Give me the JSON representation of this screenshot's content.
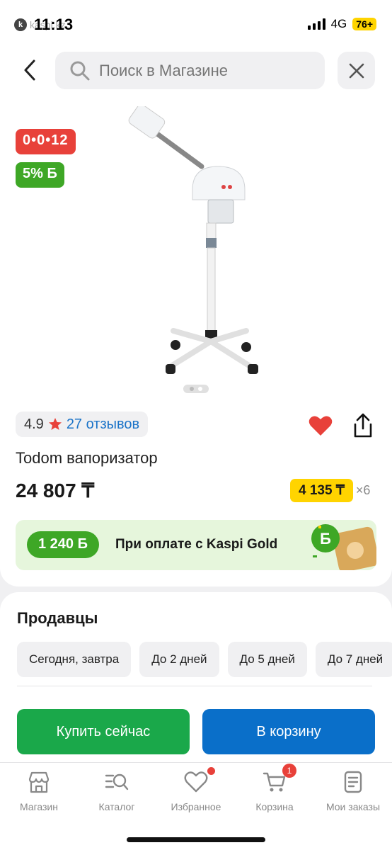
{
  "status_bar": {
    "time": "11:13",
    "app_hint": "kaspi.kz",
    "network": "4G",
    "battery": "76+"
  },
  "header": {
    "search_placeholder": "Поиск в Магазине"
  },
  "product": {
    "timer": "0•0•12",
    "bonus_badge": "5% Б",
    "rating": "4.9",
    "reviews": "27 отзывов",
    "title": "Todom вапоризатор",
    "price": "24 807 ₸",
    "installment_amount": "4 135 ₸",
    "installment_months": "×6",
    "gold_bonus": "1 240 Б",
    "gold_text": "При оплате с Kaspi Gold"
  },
  "sellers": {
    "title": "Продавцы",
    "filters": [
      "Сегодня, завтра",
      "До 2 дней",
      "До 5 дней",
      "До 7 дней"
    ],
    "buy_now": "Купить сейчас",
    "to_cart": "В корзину"
  },
  "bottom_nav": {
    "items": [
      {
        "label": "Магазин",
        "icon": "store-icon"
      },
      {
        "label": "Каталог",
        "icon": "catalog-icon"
      },
      {
        "label": "Избранное",
        "icon": "heart-outline-icon"
      },
      {
        "label": "Корзина",
        "icon": "cart-icon",
        "count": "1"
      },
      {
        "label": "Мои заказы",
        "icon": "orders-icon"
      }
    ]
  },
  "colors": {
    "accent_red": "#e8413a",
    "accent_green": "#3ea726",
    "accent_blue": "#0a6fc9",
    "accent_yellow": "#ffd400"
  }
}
